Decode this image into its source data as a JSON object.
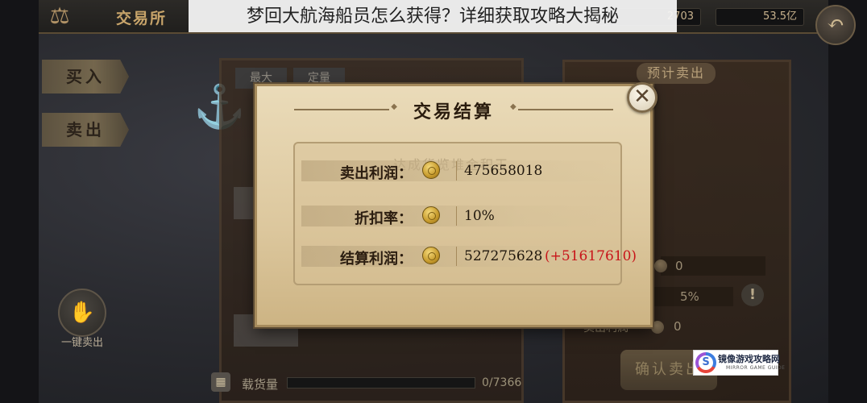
{
  "caption": "梦回大航海船员怎么获得？详细获取攻略大揭秘",
  "topbar": {
    "title": "交易所",
    "resource_1": "2703",
    "resource_2": "53.5亿"
  },
  "side_tabs": {
    "buy": "买入",
    "sell": "卖出"
  },
  "shelf_tabs": [
    "最大",
    "定量"
  ],
  "right_panel": {
    "header": "预计卖出",
    "value_1": "0",
    "discount": "5%",
    "profit_label": "卖出利润",
    "profit_value": "0",
    "confirm": "确认卖出"
  },
  "one_key": {
    "label": "一键卖出"
  },
  "cargo": {
    "label": "载货量",
    "value": "0/7366"
  },
  "dialog": {
    "title": "交易结算",
    "watermark": "达成货览堆金积玉",
    "rows": [
      {
        "label": "卖出利润：",
        "value": "475658018",
        "bonus": ""
      },
      {
        "label": "折扣率：",
        "value": "10%",
        "bonus": ""
      },
      {
        "label": "结算利润：",
        "value": "527275628",
        "bonus": "(+51617610)"
      }
    ],
    "close_symbol": "✕"
  },
  "logo": {
    "cn": "镜像游戏攻略网",
    "en": "MIRROR GAME GUIDE"
  },
  "icons": {
    "scale": "scale-icon",
    "anchor": "anchor-icon",
    "back": "back-arrow-icon",
    "coin": "gold-coin-icon",
    "warn": "exclamation-icon",
    "close": "close-icon"
  },
  "colors": {
    "bonus_red": "#c8141a",
    "parchment": "#e3d1a9",
    "gold": "#c8a46a"
  }
}
